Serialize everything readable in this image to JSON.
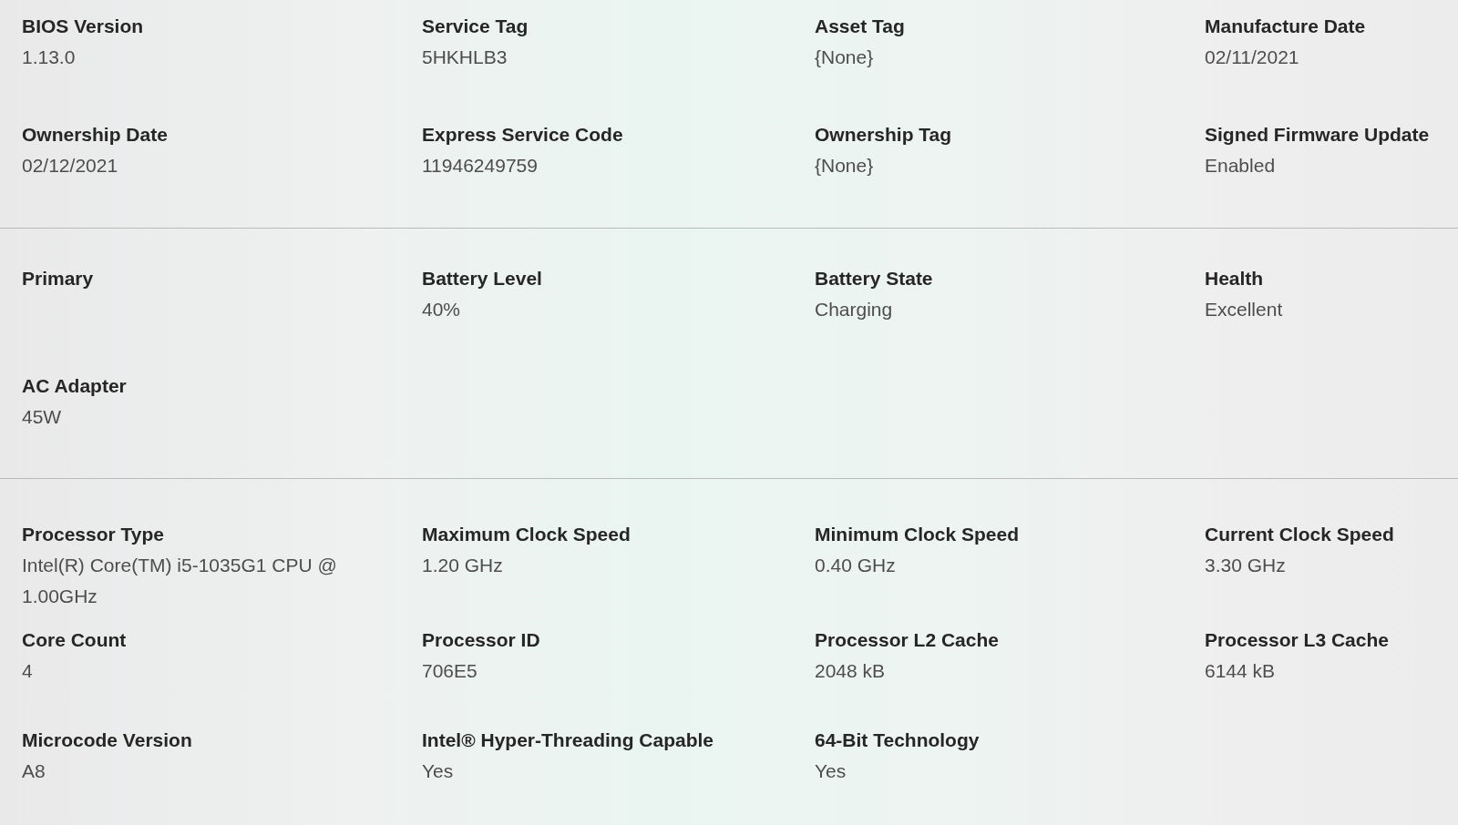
{
  "sections": [
    {
      "items": [
        {
          "label": "BIOS Version",
          "value": "1.13.0"
        },
        {
          "label": "Service Tag",
          "value": "5HKHLB3"
        },
        {
          "label": "Asset Tag",
          "value": "{None}"
        },
        {
          "label": "Manufacture Date",
          "value": "02/11/2021"
        },
        {
          "label": "Ownership Date",
          "value": "02/12/2021"
        },
        {
          "label": "Express Service Code",
          "value": "11946249759"
        },
        {
          "label": "Ownership Tag",
          "value": "{None}"
        },
        {
          "label": "Signed Firmware Update",
          "value": "Enabled"
        }
      ]
    },
    {
      "items": [
        {
          "label": "Primary"
        },
        {
          "label": "Battery Level",
          "value": "40%"
        },
        {
          "label": "Battery State",
          "value": "Charging"
        },
        {
          "label": "Health",
          "value": "Excellent"
        },
        {
          "label": "AC Adapter",
          "value": "45W"
        }
      ]
    },
    {
      "items": [
        {
          "label": "Processor Type",
          "value": "Intel(R) Core(TM) i5-1035G1 CPU @ 1.00GHz"
        },
        {
          "label": "Maximum Clock Speed",
          "value": "1.20 GHz"
        },
        {
          "label": "Minimum Clock Speed",
          "value": "0.40 GHz"
        },
        {
          "label": "Current Clock Speed",
          "value": "3.30 GHz"
        },
        {
          "label": "Core Count",
          "value": "4"
        },
        {
          "label": "Processor ID",
          "value": "706E5"
        },
        {
          "label": "Processor L2 Cache",
          "value": "2048 kB"
        },
        {
          "label": "Processor L3 Cache",
          "value": "6144 kB"
        },
        {
          "label": "Microcode Version",
          "value": "A8"
        },
        {
          "label": "Intel® Hyper-Threading Capable",
          "value": "Yes"
        },
        {
          "label": "64-Bit Technology",
          "value": "Yes"
        }
      ]
    }
  ]
}
